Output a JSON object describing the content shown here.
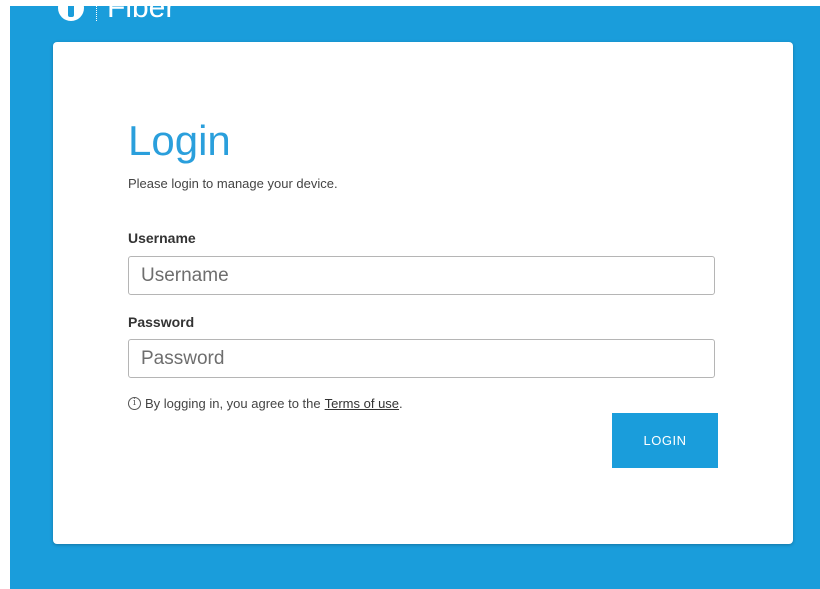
{
  "brand": {
    "name": "Fiber",
    "logo_icon": "fiber-logo-icon"
  },
  "colors": {
    "accent": "#1a9ddb",
    "title": "#2a9fdc",
    "card_bg": "#ffffff"
  },
  "login": {
    "title": "Login",
    "subtitle": "Please login to manage your device.",
    "username_label": "Username",
    "username_placeholder": "Username",
    "username_value": "",
    "password_label": "Password",
    "password_placeholder": "Password",
    "password_value": "",
    "terms_prefix": "By logging in, you agree to the",
    "terms_link": "Terms of use",
    "terms_suffix": ".",
    "info_icon": "info-icon",
    "button_label": "LOGIN"
  }
}
